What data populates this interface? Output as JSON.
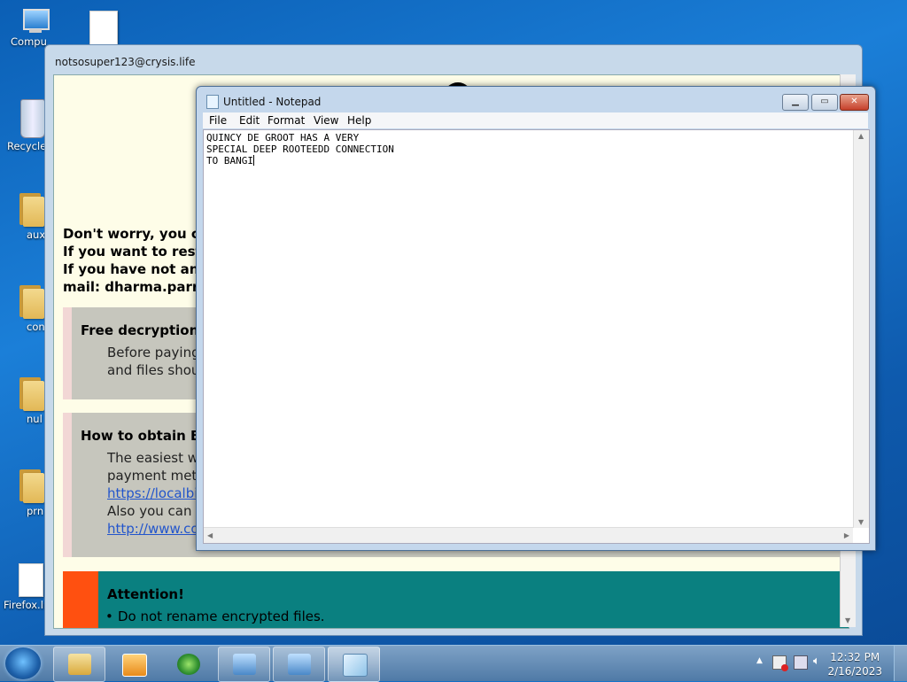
{
  "desktop": {
    "icons": [
      {
        "label": "Compu",
        "kind": "computer"
      },
      {
        "label": "",
        "kind": "file"
      },
      {
        "label": "Recycle",
        "kind": "recycle"
      },
      {
        "label": "aux",
        "kind": "folder"
      },
      {
        "label": "con",
        "kind": "folder"
      },
      {
        "label": "nul",
        "kind": "folder"
      },
      {
        "label": "prn",
        "kind": "folder"
      },
      {
        "label": "Firefox.lr",
        "kind": "file"
      }
    ]
  },
  "ransom": {
    "title": "notsosuper123@crysis.life",
    "lines": [
      "Don't worry, you can",
      "If you want to restor",
      "If you have not answ",
      "mail:  dharma.parroc"
    ],
    "box1": {
      "heading": "Free decryption a",
      "p1": "Before paying y",
      "p2": "and files should"
    },
    "box2": {
      "heading": "How to obtain Bitc",
      "p1": "The easiest wa",
      "p2": "payment metho",
      "link1": "https://localbitc",
      "p3": "Also you can fin",
      "link2": "http://www.coin"
    },
    "attention": {
      "heading": "Attention!",
      "item1": "Do not rename encrypted files."
    }
  },
  "notepad": {
    "title": "Untitled - Notepad",
    "menu": [
      "File",
      "Edit",
      "Format",
      "View",
      "Help"
    ],
    "lines": [
      "QUINCY DE GROOT HAS A VERY",
      "SPECIAL DEEP ROOTEEDD CONNECTION",
      "TO BANGI"
    ]
  },
  "taskbar": {
    "time": "12:32 PM",
    "date": "2/16/2023"
  }
}
